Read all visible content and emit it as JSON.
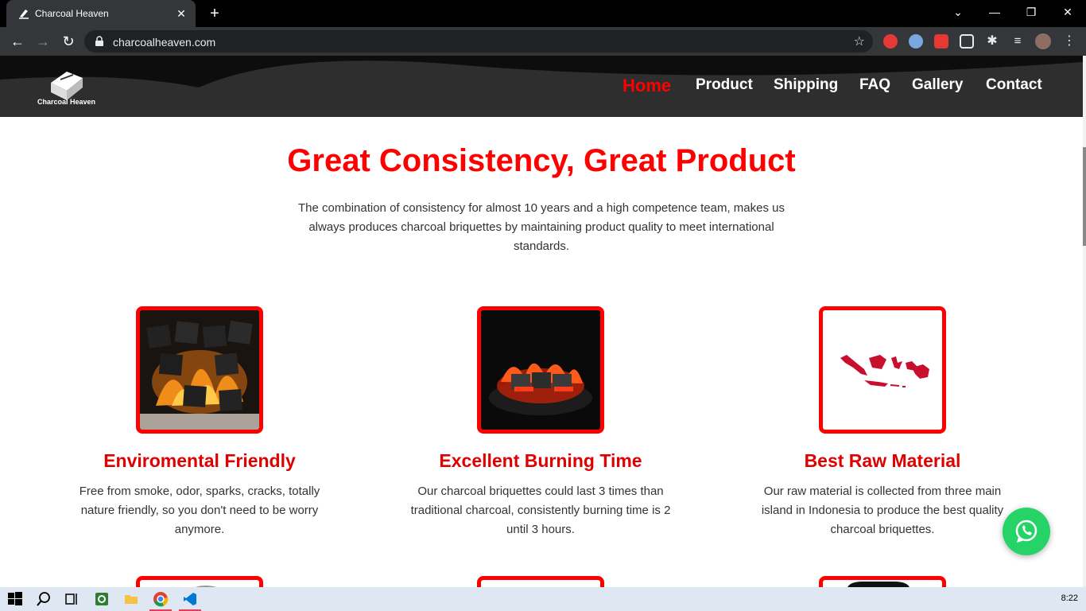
{
  "browser": {
    "tab_title": "Charcoal Heaven",
    "url": "charcoalheaven.com"
  },
  "site": {
    "logo_text": "Charcoal Heaven",
    "nav": [
      "Home",
      "Product",
      "Shipping",
      "FAQ",
      "Gallery",
      "Contact"
    ],
    "active_nav": "Home"
  },
  "hero": {
    "title": "Great Consistency, Great Product",
    "subtitle": "The combination of consistency for almost 10 years and a high competence team, makes us always produces charcoal briquettes by maintaining product quality to meet international standards."
  },
  "features": [
    {
      "title": "Enviromental Friendly",
      "text": "Free from smoke, odor, sparks, cracks, totally nature friendly, so you don't need to be worry anymore.",
      "image_icon": "burning-briquettes-image"
    },
    {
      "title": "Excellent Burning Time",
      "text": "Our charcoal briquettes could last 3 times than traditional charcoal, consistently burning time is 2 until 3 hours.",
      "image_icon": "hookah-coal-image"
    },
    {
      "title": "Best Raw Material",
      "text": "Our raw material is collected from three main island in Indonesia to produce the best quality charcoal briquettes.",
      "image_icon": "indonesia-map-image"
    }
  ],
  "taskbar": {
    "clock": "8:22"
  },
  "colors": {
    "accent": "#ff0000",
    "header_bg": "#333333",
    "whatsapp": "#25d366"
  }
}
